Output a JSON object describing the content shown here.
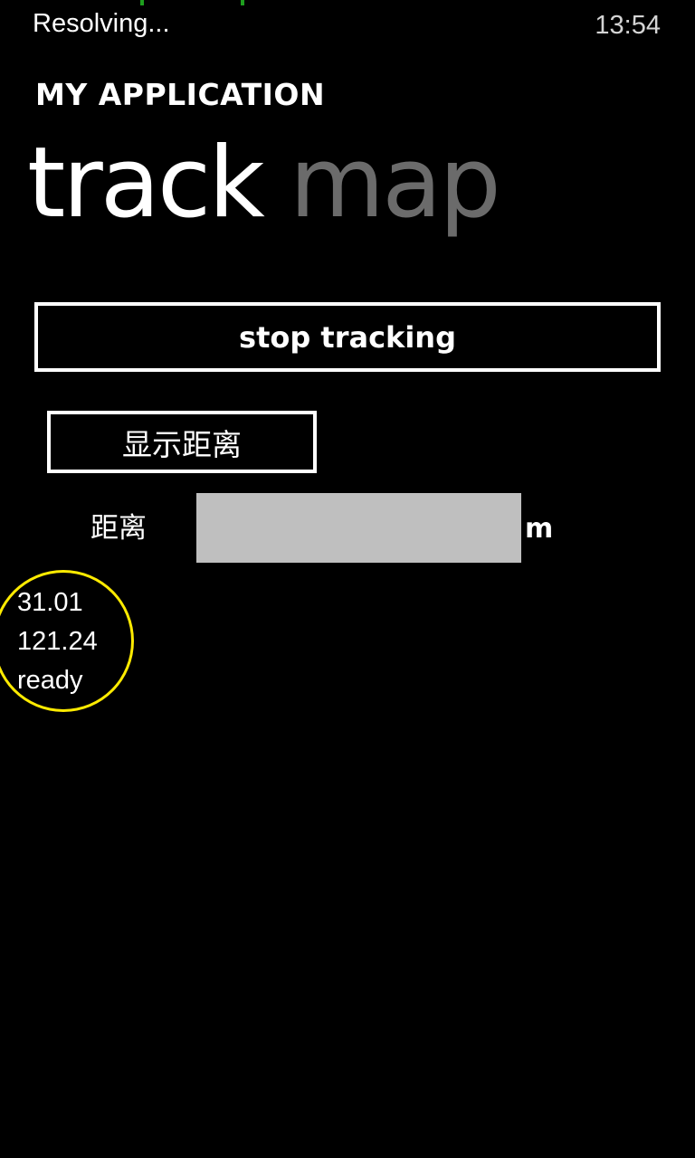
{
  "status_bar": {
    "status_text": "Resolving...",
    "clock": "13:54",
    "progress_color": "#1e9e1e"
  },
  "app": {
    "title": "MY APPLICATION"
  },
  "pivot": {
    "headers": [
      "track",
      "map"
    ],
    "active_color": "#ffffff",
    "inactive_color": "#6b6b6b"
  },
  "controls": {
    "stop_button_label": "stop tracking",
    "show_distance_button_label": "显示距离",
    "distance_label": "距离",
    "distance_value": "",
    "distance_unit": "m",
    "distance_field_color": "#bfbfbf"
  },
  "info": {
    "lines": [
      "31.01",
      "121.24",
      "ready"
    ],
    "highlight_color": "#ffeb00"
  }
}
